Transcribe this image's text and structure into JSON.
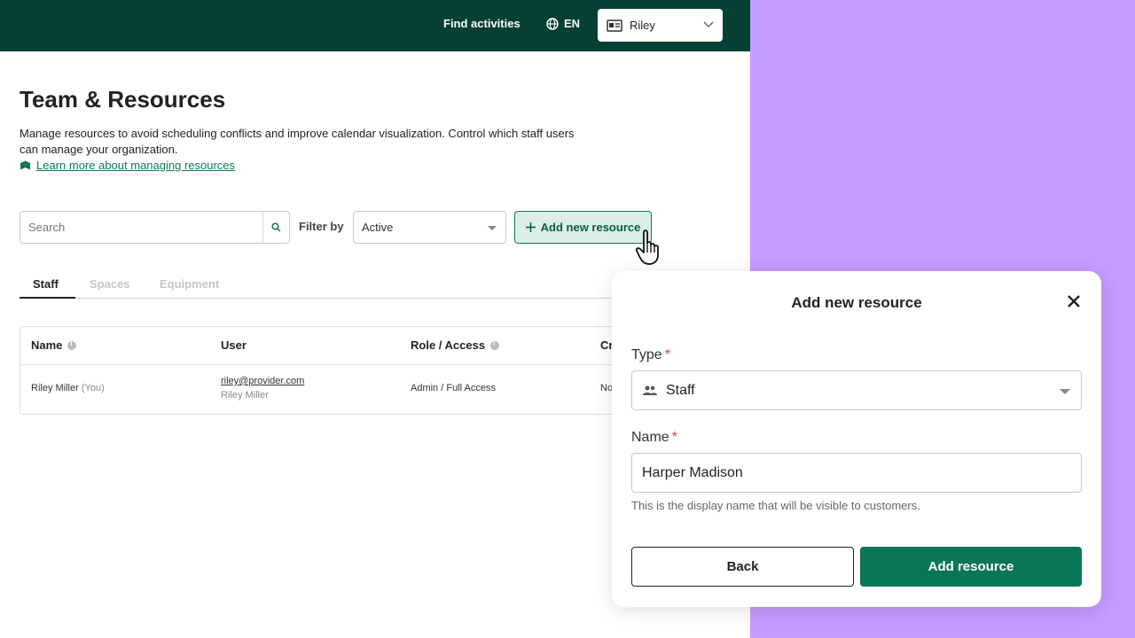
{
  "header": {
    "find_activities": "Find activities",
    "language": "EN",
    "user": "Riley"
  },
  "page": {
    "title": "Team & Resources",
    "description": "Manage resources to avoid scheduling conflicts and improve calendar visualization. Control which staff users can manage your organization.",
    "learn_more": "Learn more about managing resources"
  },
  "toolbar": {
    "search_placeholder": "Search",
    "filter_label": "Filter by",
    "filter_value": "Active",
    "add_button": "Add new resource"
  },
  "tabs": [
    {
      "label": "Staff",
      "active": true
    },
    {
      "label": "Spaces",
      "active": false
    },
    {
      "label": "Equipment",
      "active": false
    }
  ],
  "table": {
    "columns": [
      "Name",
      "User",
      "Role / Access",
      "Cr"
    ],
    "rows": [
      {
        "name": "Riley Miller",
        "name_suffix": "(You)",
        "email": "riley@provider.com",
        "user_name": "Riley Miller",
        "role": "Admin / Full Access",
        "cr": "No"
      }
    ]
  },
  "modal": {
    "title": "Add new resource",
    "type_label": "Type",
    "type_value": "Staff",
    "name_label": "Name",
    "name_value": "Harper Madison",
    "hint": "This is the display name that will be visible to customers.",
    "back": "Back",
    "submit": "Add resource",
    "required_mark": "*"
  },
  "colors": {
    "topbar": "#063f33",
    "accent": "#0b7558",
    "backdrop": "#c49bff"
  }
}
